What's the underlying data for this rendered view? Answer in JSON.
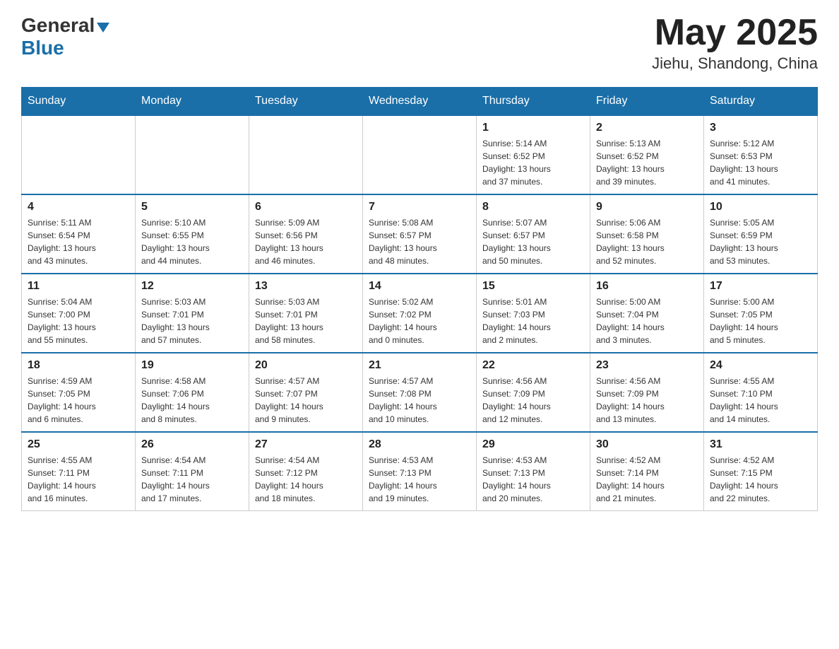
{
  "header": {
    "logo_general": "General",
    "logo_blue": "Blue",
    "title": "May 2025",
    "location": "Jiehu, Shandong, China"
  },
  "days_of_week": [
    "Sunday",
    "Monday",
    "Tuesday",
    "Wednesday",
    "Thursday",
    "Friday",
    "Saturday"
  ],
  "weeks": [
    {
      "cells": [
        {
          "day": "",
          "info": ""
        },
        {
          "day": "",
          "info": ""
        },
        {
          "day": "",
          "info": ""
        },
        {
          "day": "",
          "info": ""
        },
        {
          "day": "1",
          "info": "Sunrise: 5:14 AM\nSunset: 6:52 PM\nDaylight: 13 hours\nand 37 minutes."
        },
        {
          "day": "2",
          "info": "Sunrise: 5:13 AM\nSunset: 6:52 PM\nDaylight: 13 hours\nand 39 minutes."
        },
        {
          "day": "3",
          "info": "Sunrise: 5:12 AM\nSunset: 6:53 PM\nDaylight: 13 hours\nand 41 minutes."
        }
      ]
    },
    {
      "cells": [
        {
          "day": "4",
          "info": "Sunrise: 5:11 AM\nSunset: 6:54 PM\nDaylight: 13 hours\nand 43 minutes."
        },
        {
          "day": "5",
          "info": "Sunrise: 5:10 AM\nSunset: 6:55 PM\nDaylight: 13 hours\nand 44 minutes."
        },
        {
          "day": "6",
          "info": "Sunrise: 5:09 AM\nSunset: 6:56 PM\nDaylight: 13 hours\nand 46 minutes."
        },
        {
          "day": "7",
          "info": "Sunrise: 5:08 AM\nSunset: 6:57 PM\nDaylight: 13 hours\nand 48 minutes."
        },
        {
          "day": "8",
          "info": "Sunrise: 5:07 AM\nSunset: 6:57 PM\nDaylight: 13 hours\nand 50 minutes."
        },
        {
          "day": "9",
          "info": "Sunrise: 5:06 AM\nSunset: 6:58 PM\nDaylight: 13 hours\nand 52 minutes."
        },
        {
          "day": "10",
          "info": "Sunrise: 5:05 AM\nSunset: 6:59 PM\nDaylight: 13 hours\nand 53 minutes."
        }
      ]
    },
    {
      "cells": [
        {
          "day": "11",
          "info": "Sunrise: 5:04 AM\nSunset: 7:00 PM\nDaylight: 13 hours\nand 55 minutes."
        },
        {
          "day": "12",
          "info": "Sunrise: 5:03 AM\nSunset: 7:01 PM\nDaylight: 13 hours\nand 57 minutes."
        },
        {
          "day": "13",
          "info": "Sunrise: 5:03 AM\nSunset: 7:01 PM\nDaylight: 13 hours\nand 58 minutes."
        },
        {
          "day": "14",
          "info": "Sunrise: 5:02 AM\nSunset: 7:02 PM\nDaylight: 14 hours\nand 0 minutes."
        },
        {
          "day": "15",
          "info": "Sunrise: 5:01 AM\nSunset: 7:03 PM\nDaylight: 14 hours\nand 2 minutes."
        },
        {
          "day": "16",
          "info": "Sunrise: 5:00 AM\nSunset: 7:04 PM\nDaylight: 14 hours\nand 3 minutes."
        },
        {
          "day": "17",
          "info": "Sunrise: 5:00 AM\nSunset: 7:05 PM\nDaylight: 14 hours\nand 5 minutes."
        }
      ]
    },
    {
      "cells": [
        {
          "day": "18",
          "info": "Sunrise: 4:59 AM\nSunset: 7:05 PM\nDaylight: 14 hours\nand 6 minutes."
        },
        {
          "day": "19",
          "info": "Sunrise: 4:58 AM\nSunset: 7:06 PM\nDaylight: 14 hours\nand 8 minutes."
        },
        {
          "day": "20",
          "info": "Sunrise: 4:57 AM\nSunset: 7:07 PM\nDaylight: 14 hours\nand 9 minutes."
        },
        {
          "day": "21",
          "info": "Sunrise: 4:57 AM\nSunset: 7:08 PM\nDaylight: 14 hours\nand 10 minutes."
        },
        {
          "day": "22",
          "info": "Sunrise: 4:56 AM\nSunset: 7:09 PM\nDaylight: 14 hours\nand 12 minutes."
        },
        {
          "day": "23",
          "info": "Sunrise: 4:56 AM\nSunset: 7:09 PM\nDaylight: 14 hours\nand 13 minutes."
        },
        {
          "day": "24",
          "info": "Sunrise: 4:55 AM\nSunset: 7:10 PM\nDaylight: 14 hours\nand 14 minutes."
        }
      ]
    },
    {
      "cells": [
        {
          "day": "25",
          "info": "Sunrise: 4:55 AM\nSunset: 7:11 PM\nDaylight: 14 hours\nand 16 minutes."
        },
        {
          "day": "26",
          "info": "Sunrise: 4:54 AM\nSunset: 7:11 PM\nDaylight: 14 hours\nand 17 minutes."
        },
        {
          "day": "27",
          "info": "Sunrise: 4:54 AM\nSunset: 7:12 PM\nDaylight: 14 hours\nand 18 minutes."
        },
        {
          "day": "28",
          "info": "Sunrise: 4:53 AM\nSunset: 7:13 PM\nDaylight: 14 hours\nand 19 minutes."
        },
        {
          "day": "29",
          "info": "Sunrise: 4:53 AM\nSunset: 7:13 PM\nDaylight: 14 hours\nand 20 minutes."
        },
        {
          "day": "30",
          "info": "Sunrise: 4:52 AM\nSunset: 7:14 PM\nDaylight: 14 hours\nand 21 minutes."
        },
        {
          "day": "31",
          "info": "Sunrise: 4:52 AM\nSunset: 7:15 PM\nDaylight: 14 hours\nand 22 minutes."
        }
      ]
    }
  ]
}
